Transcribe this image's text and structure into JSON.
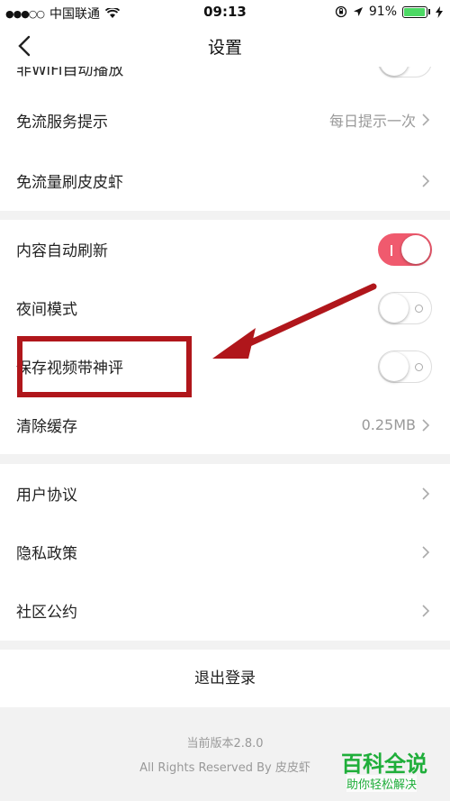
{
  "status_bar": {
    "carrier": "中国联通",
    "time": "09:13",
    "battery": "91%"
  },
  "nav": {
    "title": "设置"
  },
  "partial_row": {
    "label": "非WiFi自动播放"
  },
  "group1": [
    {
      "label": "免流服务提示",
      "value": "每日提示一次"
    },
    {
      "label": "免流量刷皮皮虾",
      "value": ""
    }
  ],
  "group2": [
    {
      "label": "内容自动刷新",
      "toggle": true
    },
    {
      "label": "夜间模式",
      "toggle": false
    },
    {
      "label": "保存视频带神评",
      "toggle": false
    },
    {
      "label": "清除缓存",
      "value": "0.25MB"
    }
  ],
  "group3": [
    {
      "label": "用户协议"
    },
    {
      "label": "隐私政策"
    },
    {
      "label": "社区公约"
    }
  ],
  "logout_label": "退出登录",
  "footer": {
    "version": "当前版本2.8.0",
    "rights": "All Rights Reserved By 皮皮虾"
  },
  "watermark": {
    "title": "百科全说",
    "subtitle": "助你轻松解决"
  },
  "colors": {
    "accent": "#f05a6e",
    "annotation": "#b0161b"
  }
}
